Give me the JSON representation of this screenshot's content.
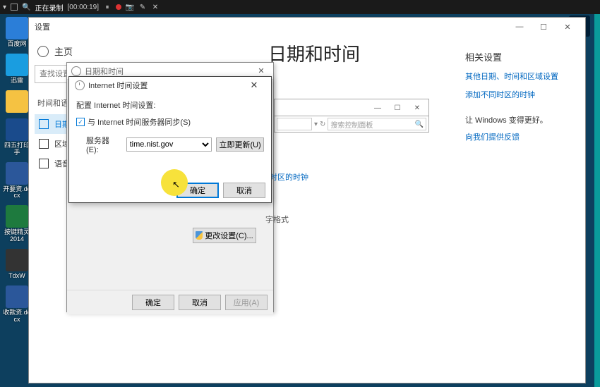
{
  "recbar": {
    "status": "正在录制",
    "time": "[00:00:19]"
  },
  "desktop": [
    {
      "label": "百度网",
      "bg": "#2b7ed8"
    },
    {
      "label": "迅雷",
      "bg": "#1a9de0"
    },
    {
      "label": "",
      "bg": "#f5c242"
    },
    {
      "label": "四五打印手",
      "bg": "#1a4b8c"
    },
    {
      "label": "开要资.docx",
      "bg": "#2b579a"
    },
    {
      "label": "按键精灵2014",
      "bg": "#1e7a3e"
    },
    {
      "label": "TdxW",
      "bg": "#333"
    },
    {
      "label": "收款资.docx",
      "bg": "#2b579a"
    }
  ],
  "settings": {
    "title": "设置",
    "home": "主页",
    "search_placeholder": "查找设置",
    "section": "时间和语言",
    "nav": [
      {
        "label": "日期和时间",
        "active": true
      },
      {
        "label": "区域和"
      },
      {
        "label": "语音"
      }
    ],
    "page_header": "日期和时间",
    "related": {
      "title": "相关设置",
      "link1": "其他日期、时间和区域设置",
      "link2": "添加不同时区的时钟",
      "sub": "让 Windows 变得更好。",
      "feedback": "向我们提供反馈"
    }
  },
  "cp": {
    "search_placeholder": "搜索控制面板",
    "link_tz": "添加不同时区的时钟",
    "txt_format": "字格式"
  },
  "dt_dialog": {
    "title": "日期和时间",
    "change_settings": "更改设置(C)...",
    "ok": "确定",
    "cancel": "取消",
    "apply": "应用(A)"
  },
  "its_dialog": {
    "title": "Internet 时间设置",
    "heading": "配置 Internet 时间设置:",
    "sync_label": "与 Internet 时间服务器同步(S)",
    "server_label": "服务器(E):",
    "server_value": "time.nist.gov",
    "update_btn": "立即更新(U)",
    "ok": "确定",
    "cancel": "取消"
  }
}
